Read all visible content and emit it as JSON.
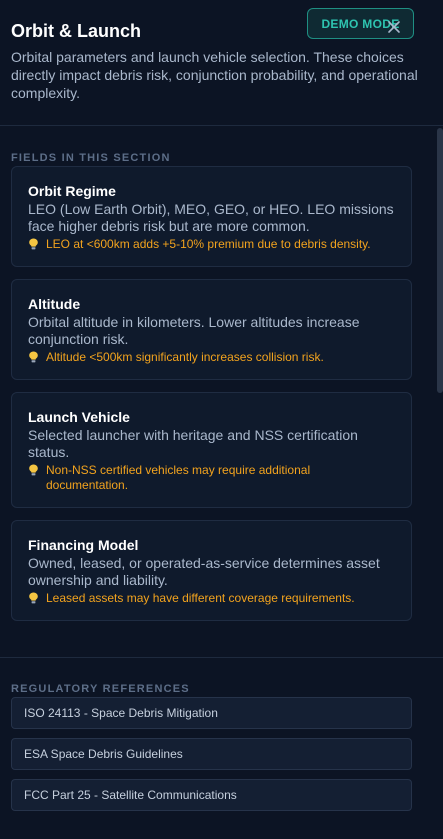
{
  "header": {
    "title": "Orbit & Launch",
    "subtitle": "Orbital parameters and launch vehicle selection. These choices directly impact debris risk, conjunction probability, and operational complexity.",
    "demo_badge": "DEMO MODE",
    "close_icon": "close-icon"
  },
  "fields_section": {
    "label": "FIELDS IN THIS SECTION",
    "fields": [
      {
        "title": "Orbit Regime",
        "description": "LEO (Low Earth Orbit), MEO, GEO, or HEO. LEO missions face higher debris risk but are more common.",
        "tip": "LEO at <600km adds +5-10% premium due to debris density.",
        "tip_icon": "lightbulb-icon"
      },
      {
        "title": "Altitude",
        "description": "Orbital altitude in kilometers. Lower altitudes increase conjunction risk.",
        "tip": "Altitude <500km significantly increases collision risk.",
        "tip_icon": "lightbulb-icon"
      },
      {
        "title": "Launch Vehicle",
        "description": "Selected launcher with heritage and NSS certification status.",
        "tip": "Non-NSS certified vehicles may require additional documentation.",
        "tip_icon": "lightbulb-icon"
      },
      {
        "title": "Financing Model",
        "description": "Owned, leased, or operated-as-service determines asset ownership and liability.",
        "tip": "Leased assets may have different coverage requirements.",
        "tip_icon": "lightbulb-icon"
      }
    ]
  },
  "references_section": {
    "label": "REGULATORY REFERENCES",
    "items": [
      "ISO 24113 - Space Debris Mitigation",
      "ESA Space Debris Guidelines",
      "FCC Part 25 - Satellite Communications"
    ]
  },
  "colors": {
    "background": "#0c1424",
    "accent_teal": "#2ec4b0",
    "tip_amber": "#f2a31e"
  }
}
